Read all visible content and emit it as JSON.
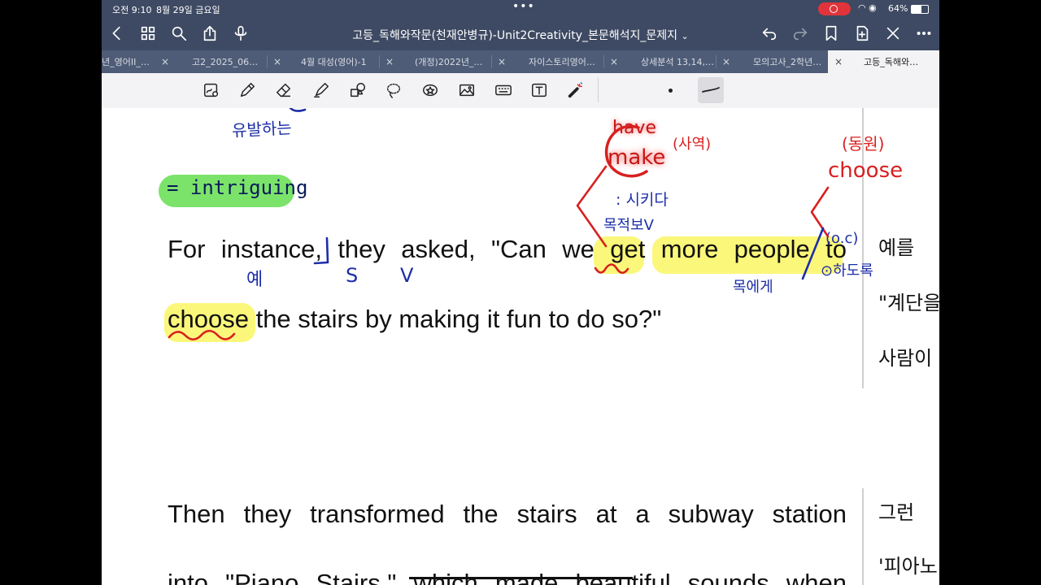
{
  "status": {
    "time": "오전 9:10",
    "date": "8월 29일 금요일",
    "battery": "64%"
  },
  "nav": {
    "title": "고등_독해와작문(천재안병규)-Unit2Creativity_본문해석지_문제지",
    "title_caret": "⌄"
  },
  "tabs": [
    {
      "label": "년_영어II_…"
    },
    {
      "label": "고2_2025_06…"
    },
    {
      "label": "4월 대성(영어)-1"
    },
    {
      "label": "(개정)2022년_…"
    },
    {
      "label": "자이스토리영어…"
    },
    {
      "label": "상세분석 13,14,…"
    },
    {
      "label": "모의고사_2학년…"
    },
    {
      "label": "고등_독해와…",
      "active": true
    }
  ],
  "tab_close": "×",
  "document": {
    "line1": "For instance, they asked, \"Can we get more people to",
    "line2": "choose the stairs by making it fun to do so?\"",
    "line3": "Then they transformed the stairs at a subway station",
    "line4": "into \"Piano Stairs,\" which made beautiful sounds when",
    "kor1": "예를",
    "kor2": "\"계단을",
    "kor3": "사람이",
    "kor4": "그런",
    "kor5": "'피아노"
  },
  "annotations": {
    "intriguing": "= intriguing",
    "yuballhada": "유발하는",
    "ye": "예",
    "s": "S",
    "v": "V",
    "have": "have",
    "make": "make",
    "sayeok": "(사역)",
    "sikida": ": 시키다",
    "mokjeok": "목적보V",
    "dongwon": "(동원)",
    "choose": "choose",
    "oc": "(o.c)",
    "hadorok": "⊙하도록",
    "mokege": "목에게"
  },
  "colors": {
    "chrome": "#3e4a63",
    "tabbar": "#4f5c77",
    "highlight_yellow": "#fbf77a",
    "highlight_green": "#7be36a",
    "ink_blue": "#1d2ea8",
    "ink_red": "#d82020",
    "record": "#e0343a"
  }
}
